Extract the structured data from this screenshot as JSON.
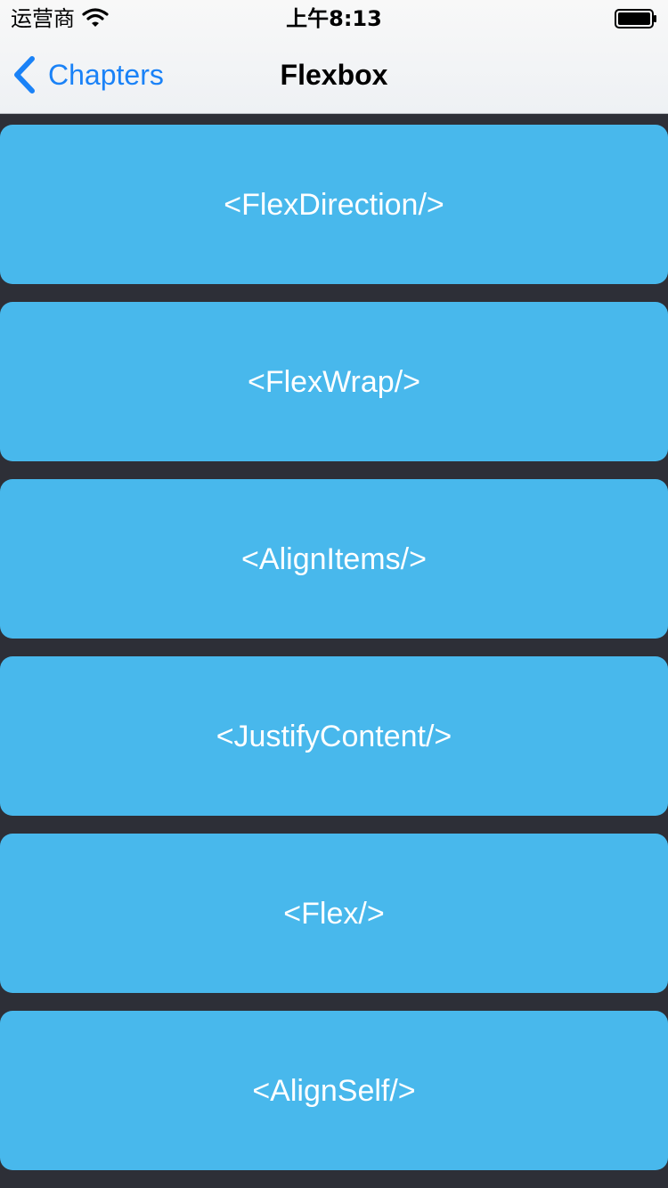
{
  "status_bar": {
    "carrier": "运营商",
    "time": "上午8:13"
  },
  "nav": {
    "back_label": "Chapters",
    "title": "Flexbox"
  },
  "items": [
    {
      "label": "<FlexDirection/>"
    },
    {
      "label": "<FlexWrap/>"
    },
    {
      "label": "<AlignItems/>"
    },
    {
      "label": "<JustifyContent/>"
    },
    {
      "label": "<Flex/>"
    },
    {
      "label": "<AlignSelf/>"
    }
  ],
  "colors": {
    "accent": "#1a82f7",
    "card": "#48b8ec",
    "background": "#2d2f37"
  },
  "icons": {
    "back": "chevron-left-icon",
    "wifi": "wifi-icon",
    "battery": "battery-icon"
  }
}
